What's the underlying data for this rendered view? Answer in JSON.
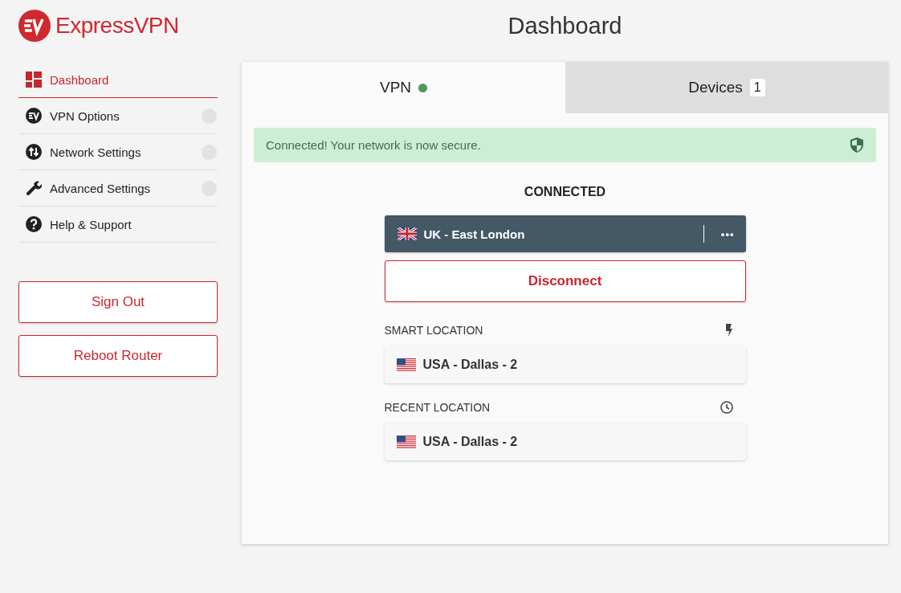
{
  "brand": "ExpressVPN",
  "page_title": "Dashboard",
  "sidebar": {
    "items": [
      {
        "label": "Dashboard",
        "selected": true,
        "expandable": false
      },
      {
        "label": "VPN Options",
        "selected": false,
        "expandable": true
      },
      {
        "label": "Network Settings",
        "selected": false,
        "expandable": true
      },
      {
        "label": "Advanced Settings",
        "selected": false,
        "expandable": true
      },
      {
        "label": "Help & Support",
        "selected": false,
        "expandable": false
      }
    ],
    "buttons": [
      "Sign Out",
      "Reboot Router"
    ]
  },
  "tabs": [
    {
      "label": "VPN",
      "selected": true,
      "color": "#4e9a5a"
    },
    {
      "label": "Devices",
      "selected": false,
      "badge": "1"
    }
  ],
  "alert": {
    "text": "Connected! Your network is now secure."
  },
  "status": "CONNECTED",
  "current_location": {
    "name": "UK - East London",
    "more": "•••"
  },
  "disconnect_button": "Disconnect",
  "sections": [
    {
      "kind": "smart",
      "title": "SMART LOCATION",
      "location": "USA - Dallas - 2"
    },
    {
      "kind": "recent",
      "title": "RECENT LOCATION",
      "location": "USA - Dallas - 2"
    }
  ]
}
